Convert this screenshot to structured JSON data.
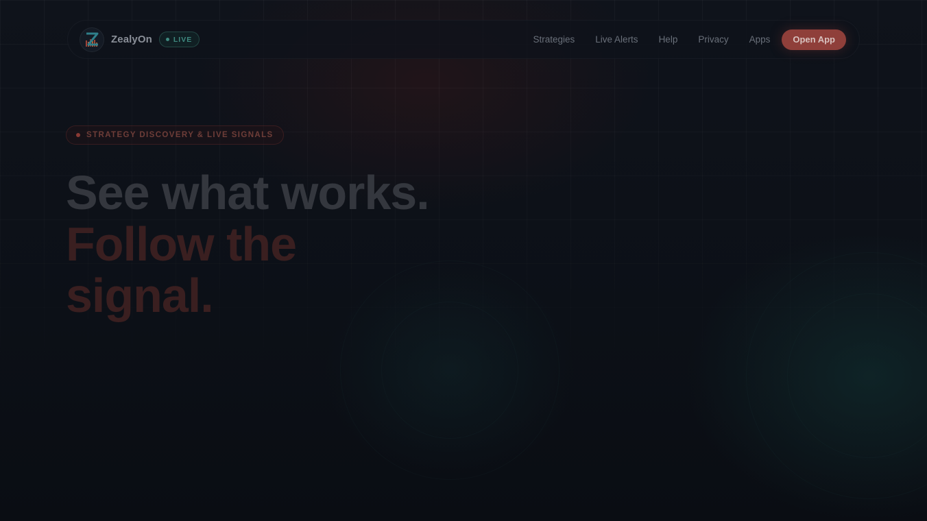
{
  "brand": {
    "name": "ZealyOn",
    "logo_icon": "zealyon-logo-icon",
    "live_badge": "LIVE",
    "live_color": "#3f8a80"
  },
  "nav": {
    "links": [
      "Strategies",
      "Live Alerts",
      "Help",
      "Privacy",
      "Apps"
    ],
    "cta_label": "Open App",
    "cta_color": "#8f3f3a"
  },
  "hero": {
    "eyebrow": "STRATEGY DISCOVERY & LIVE SIGNALS",
    "eyebrow_dot_color": "#8a3a34",
    "headline_line1": "See what works.",
    "headline_line2": "Follow the",
    "headline_line3": "signal."
  },
  "theme": {
    "background": "#0b0f16",
    "accent_red": "#8f3f3a",
    "accent_teal": "#3f8a80"
  }
}
